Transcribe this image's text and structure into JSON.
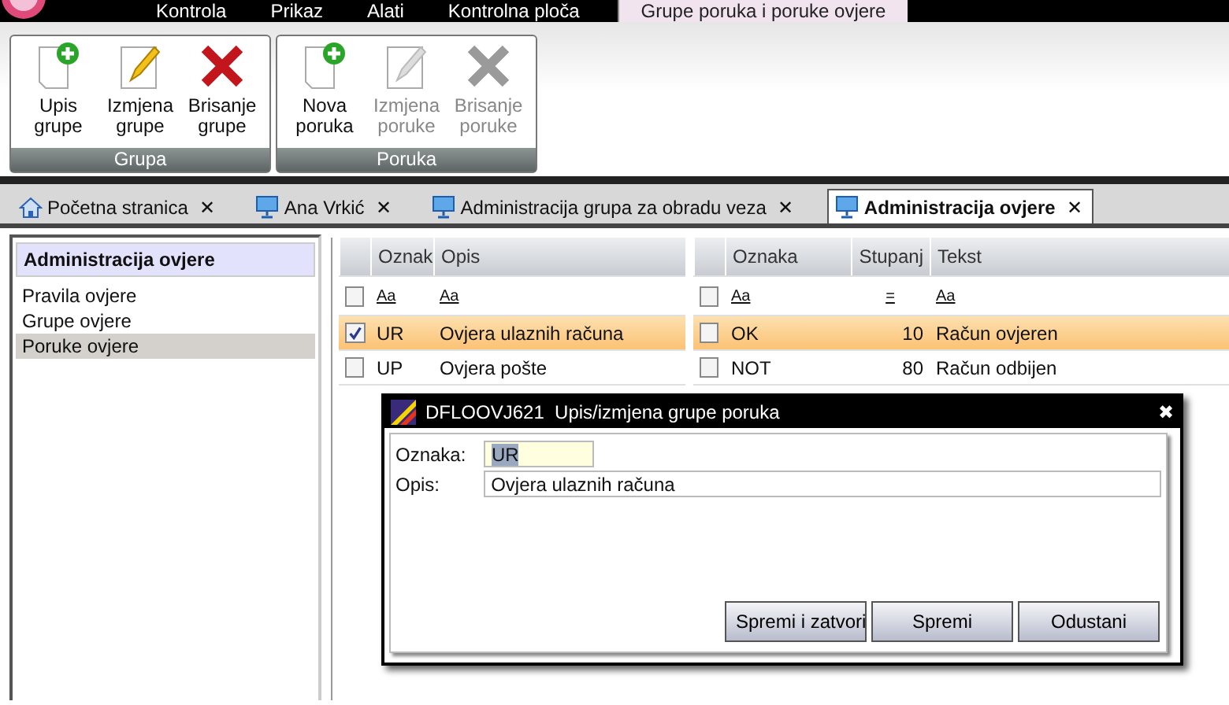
{
  "menu": {
    "tabs": [
      {
        "label": "Kontrola",
        "selected": false
      },
      {
        "label": "Prikaz",
        "selected": false
      },
      {
        "label": "Alati",
        "selected": false
      },
      {
        "label": "Kontrolna ploča",
        "selected": false
      },
      {
        "label": "Grupe poruka i poruke ovjere",
        "selected": true
      }
    ]
  },
  "ribbon": {
    "groups": [
      {
        "label": "Grupa",
        "buttons": [
          {
            "label": "Upis grupe",
            "kind": "add",
            "disabled": false
          },
          {
            "label": "Izmjena grupe",
            "kind": "edit",
            "disabled": false
          },
          {
            "label": "Brisanje grupe",
            "kind": "delete",
            "disabled": false
          }
        ]
      },
      {
        "label": "Poruka",
        "buttons": [
          {
            "label": "Nova poruka",
            "kind": "add",
            "disabled": false
          },
          {
            "label": "Izmjena poruke",
            "kind": "edit",
            "disabled": true
          },
          {
            "label": "Brisanje poruke",
            "kind": "delete",
            "disabled": true
          }
        ]
      }
    ]
  },
  "doc_tabs": [
    {
      "label": "Početna stranica",
      "kind": "home",
      "selected": false
    },
    {
      "label": "Ana Vrkić",
      "kind": "monitor",
      "selected": false
    },
    {
      "label": "Administracija grupa za obradu veza",
      "kind": "monitor",
      "selected": false
    },
    {
      "label": "Administracija ovjere",
      "kind": "monitor",
      "selected": true
    }
  ],
  "doc_tab_close": "✕",
  "sidebar": {
    "title": "Administracija ovjere",
    "items": [
      {
        "label": "Pravila ovjere",
        "selected": false
      },
      {
        "label": "Grupe ovjere",
        "selected": false
      },
      {
        "label": "Poruke ovjere",
        "selected": true
      }
    ]
  },
  "grids": [
    {
      "columns": [
        {
          "label": "Oznak",
          "kind": "text"
        },
        {
          "label": "Opis",
          "kind": "text"
        }
      ],
      "filter_checked": false,
      "filters": [
        "Aa",
        "Aa"
      ],
      "rows": [
        {
          "checked": true,
          "selected": true,
          "cells": [
            "UR",
            "Ovjera ulaznih računa"
          ]
        },
        {
          "checked": false,
          "selected": false,
          "cells": [
            "UP",
            "Ovjera pošte"
          ]
        }
      ]
    },
    {
      "columns": [
        {
          "label": "Oznaka",
          "kind": "text"
        },
        {
          "label": "Stupanj",
          "kind": "number"
        },
        {
          "label": "Tekst",
          "kind": "text"
        }
      ],
      "filter_checked": false,
      "filters": [
        "Aa",
        "=",
        "Aa"
      ],
      "rows": [
        {
          "checked": false,
          "selected": true,
          "cells": [
            "OK",
            "10",
            "Račun ovjeren"
          ]
        },
        {
          "checked": false,
          "selected": false,
          "cells": [
            "NOT",
            "80",
            "Račun odbijen"
          ]
        }
      ]
    }
  ],
  "dialog": {
    "title": "DFLOOVJ621  Upis/izmjena grupe poruka",
    "close": "✖",
    "fields": [
      {
        "label": "Oznaka:",
        "value": "UR",
        "highlighted": true
      },
      {
        "label": "Opis:",
        "value": "Ovjera ulaznih računa",
        "highlighted": false
      }
    ],
    "buttons": [
      "Spremi i zatvori",
      "Spremi",
      "Odustani"
    ]
  }
}
